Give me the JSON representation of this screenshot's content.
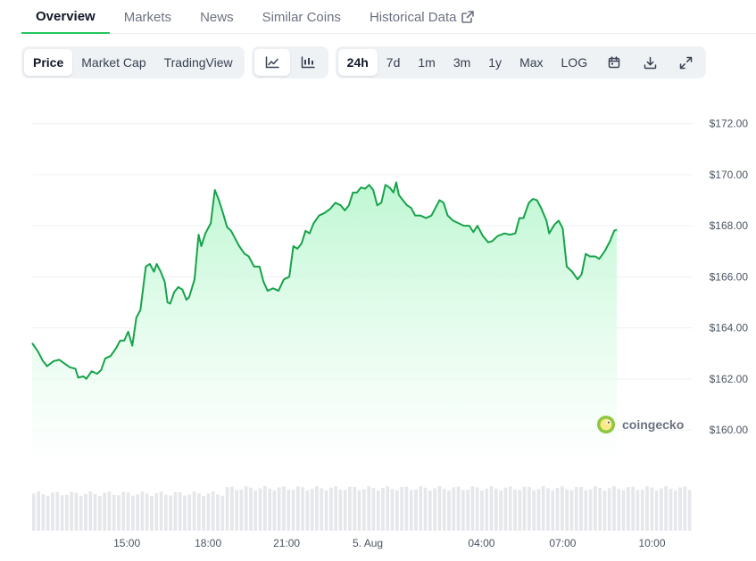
{
  "tabs": [
    {
      "label": "Overview",
      "active": true
    },
    {
      "label": "Markets",
      "active": false
    },
    {
      "label": "News",
      "active": false
    },
    {
      "label": "Similar Coins",
      "active": false
    },
    {
      "label": "Historical Data",
      "active": false,
      "external": true
    }
  ],
  "toolbar": {
    "view_types": [
      {
        "label": "Price",
        "active": true
      },
      {
        "label": "Market Cap",
        "active": false
      },
      {
        "label": "TradingView",
        "active": false
      }
    ],
    "chart_styles": [
      {
        "icon": "line-chart-icon",
        "active": true
      },
      {
        "icon": "candlestick-chart-icon",
        "active": false
      }
    ],
    "ranges": [
      {
        "label": "24h",
        "active": true
      },
      {
        "label": "7d",
        "active": false
      },
      {
        "label": "1m",
        "active": false
      },
      {
        "label": "3m",
        "active": false
      },
      {
        "label": "1y",
        "active": false
      },
      {
        "label": "Max",
        "active": false
      },
      {
        "label": "LOG",
        "active": false
      }
    ],
    "tools": [
      "calendar-icon",
      "download-icon",
      "fullscreen-icon"
    ]
  },
  "watermark": "coingecko",
  "colors": {
    "line": "#16a34a",
    "fill_top": "#bbf7d0",
    "accent": "#22c55e",
    "volume": "#e5e7eb"
  },
  "chart_data": {
    "type": "area",
    "ylim": [
      158.5,
      173
    ],
    "y_ticks": [
      {
        "value": 172,
        "label": "$172.00"
      },
      {
        "value": 170,
        "label": "$170.00"
      },
      {
        "value": 168,
        "label": "$168.00"
      },
      {
        "value": 166,
        "label": "$166.00"
      },
      {
        "value": 164,
        "label": "$164.00"
      },
      {
        "value": 162,
        "label": "$162.00"
      },
      {
        "value": 160,
        "label": "$160.00"
      }
    ],
    "x_ticks": [
      {
        "hour": 3.5,
        "label": "15:00"
      },
      {
        "hour": 6.5,
        "label": "18:00"
      },
      {
        "hour": 9.4,
        "label": "21:00"
      },
      {
        "hour": 12.4,
        "label": "5. Aug"
      },
      {
        "hour": 16.6,
        "label": "04:00"
      },
      {
        "hour": 19.6,
        "label": "07:00"
      },
      {
        "hour": 22.9,
        "label": "10:00"
      }
    ],
    "x_range_hours": [
      0,
      24.4
    ],
    "grid": true,
    "series": [
      {
        "points": [
          [
            0.0,
            163.4
          ],
          [
            0.2,
            163.1
          ],
          [
            0.4,
            162.7
          ],
          [
            0.55,
            162.5
          ],
          [
            0.8,
            162.7
          ],
          [
            1.0,
            162.75
          ],
          [
            1.2,
            162.6
          ],
          [
            1.4,
            162.45
          ],
          [
            1.6,
            162.4
          ],
          [
            1.7,
            162.05
          ],
          [
            1.9,
            162.1
          ],
          [
            2.0,
            162.0
          ],
          [
            2.2,
            162.3
          ],
          [
            2.4,
            162.2
          ],
          [
            2.55,
            162.35
          ],
          [
            2.7,
            162.8
          ],
          [
            2.9,
            162.9
          ],
          [
            3.1,
            163.2
          ],
          [
            3.25,
            163.5
          ],
          [
            3.4,
            163.5
          ],
          [
            3.55,
            163.85
          ],
          [
            3.7,
            163.3
          ],
          [
            3.85,
            164.4
          ],
          [
            4.0,
            164.7
          ],
          [
            4.2,
            166.4
          ],
          [
            4.35,
            166.5
          ],
          [
            4.5,
            166.2
          ],
          [
            4.6,
            166.5
          ],
          [
            4.75,
            166.2
          ],
          [
            4.9,
            165.8
          ],
          [
            5.0,
            165.0
          ],
          [
            5.1,
            164.95
          ],
          [
            5.25,
            165.4
          ],
          [
            5.4,
            165.6
          ],
          [
            5.55,
            165.5
          ],
          [
            5.7,
            165.1
          ],
          [
            5.8,
            165.2
          ],
          [
            6.0,
            165.9
          ],
          [
            6.15,
            167.65
          ],
          [
            6.25,
            167.2
          ],
          [
            6.4,
            167.7
          ],
          [
            6.6,
            168.1
          ],
          [
            6.75,
            169.4
          ],
          [
            6.9,
            169.0
          ],
          [
            7.05,
            168.5
          ],
          [
            7.2,
            167.95
          ],
          [
            7.35,
            167.8
          ],
          [
            7.5,
            167.5
          ],
          [
            7.65,
            167.2
          ],
          [
            7.85,
            166.9
          ],
          [
            8.0,
            166.8
          ],
          [
            8.2,
            166.4
          ],
          [
            8.4,
            166.4
          ],
          [
            8.55,
            165.8
          ],
          [
            8.7,
            165.45
          ],
          [
            8.9,
            165.55
          ],
          [
            9.1,
            165.45
          ],
          [
            9.3,
            165.9
          ],
          [
            9.5,
            166.0
          ],
          [
            9.65,
            167.2
          ],
          [
            9.8,
            167.1
          ],
          [
            9.95,
            167.3
          ],
          [
            10.1,
            167.8
          ],
          [
            10.25,
            167.7
          ],
          [
            10.4,
            168.1
          ],
          [
            10.6,
            168.4
          ],
          [
            10.8,
            168.5
          ],
          [
            11.0,
            168.65
          ],
          [
            11.2,
            168.9
          ],
          [
            11.4,
            168.8
          ],
          [
            11.55,
            168.6
          ],
          [
            11.7,
            168.8
          ],
          [
            11.85,
            169.3
          ],
          [
            12.0,
            169.3
          ],
          [
            12.15,
            169.5
          ],
          [
            12.3,
            169.45
          ],
          [
            12.45,
            169.6
          ],
          [
            12.6,
            169.4
          ],
          [
            12.75,
            168.8
          ],
          [
            12.9,
            168.9
          ],
          [
            13.05,
            169.6
          ],
          [
            13.2,
            169.5
          ],
          [
            13.35,
            169.3
          ],
          [
            13.45,
            169.7
          ],
          [
            13.55,
            169.2
          ],
          [
            13.7,
            169.0
          ],
          [
            13.85,
            168.8
          ],
          [
            14.0,
            168.7
          ],
          [
            14.15,
            168.4
          ],
          [
            14.35,
            168.4
          ],
          [
            14.55,
            168.3
          ],
          [
            14.75,
            168.4
          ],
          [
            14.9,
            168.7
          ],
          [
            15.05,
            169.0
          ],
          [
            15.2,
            168.9
          ],
          [
            15.35,
            168.4
          ],
          [
            15.55,
            168.2
          ],
          [
            15.75,
            168.1
          ],
          [
            15.95,
            168.0
          ],
          [
            16.15,
            168.0
          ],
          [
            16.3,
            167.75
          ],
          [
            16.45,
            168.0
          ],
          [
            16.65,
            167.6
          ],
          [
            16.85,
            167.35
          ],
          [
            17.0,
            167.4
          ],
          [
            17.2,
            167.6
          ],
          [
            17.45,
            167.7
          ],
          [
            17.65,
            167.65
          ],
          [
            17.85,
            167.7
          ],
          [
            18.0,
            168.3
          ],
          [
            18.15,
            168.3
          ],
          [
            18.35,
            168.9
          ],
          [
            18.5,
            169.05
          ],
          [
            18.65,
            169.0
          ],
          [
            18.8,
            168.7
          ],
          [
            19.0,
            168.2
          ],
          [
            19.1,
            167.7
          ],
          [
            19.3,
            168.05
          ],
          [
            19.45,
            168.2
          ],
          [
            19.6,
            167.9
          ],
          [
            19.75,
            166.4
          ],
          [
            19.95,
            166.2
          ],
          [
            20.15,
            165.9
          ],
          [
            20.3,
            166.1
          ],
          [
            20.45,
            166.9
          ],
          [
            20.6,
            166.8
          ],
          [
            20.8,
            166.8
          ],
          [
            20.95,
            166.7
          ],
          [
            21.15,
            167.0
          ],
          [
            21.35,
            167.4
          ],
          [
            21.5,
            167.8
          ],
          [
            21.6,
            167.85
          ]
        ]
      }
    ],
    "volume_range": [
      0.6,
      1.0
    ]
  }
}
